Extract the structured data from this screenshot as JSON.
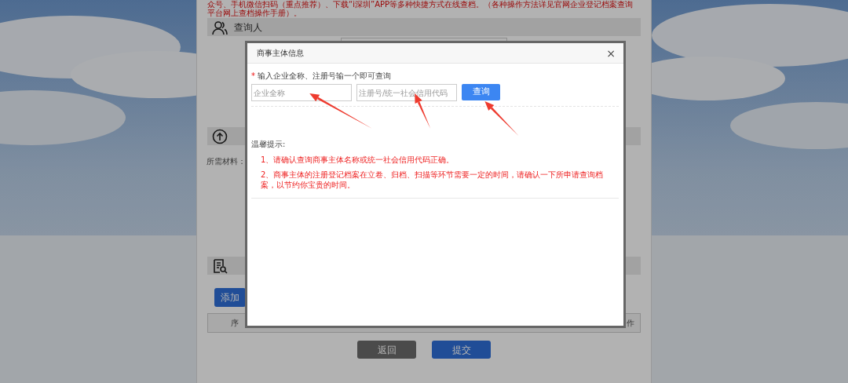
{
  "page": {
    "notice": "众号、手机微信扫码（重点推荐）、下载“i深圳”APP等多种快捷方式在线查档。（各种操作方法详见官网企业登记档案查询平台网上查档操作手册）。",
    "sections": [
      {
        "kind": "people",
        "title": "查询人"
      },
      {
        "kind": "upload",
        "materials_label": "所需材料："
      },
      {
        "kind": "document",
        "add_button": "添加",
        "table_columns": [
          "序",
          "作"
        ]
      }
    ],
    "footer_buttons": [
      {
        "label": "返回",
        "kind": "secondary"
      },
      {
        "label": "提交",
        "kind": "primary"
      }
    ]
  },
  "modal": {
    "title": "商事主体信息",
    "close": "×",
    "prompt_mark": "*",
    "prompt": "输入企业全称、注册号输一个即可查询",
    "fields": [
      {
        "placeholder": "企业全称",
        "arrow": true
      },
      {
        "placeholder": "注册号/统一社会信用代码",
        "arrow": true
      }
    ],
    "search_button": {
      "label": "查询",
      "arrow": true
    },
    "tips_title": "温馨提示:",
    "tips": [
      "1、请确认查询商事主体名称或统一社会信用代码正确。",
      "2、商事主体的注册登记档案在立卷、归档、扫描等环节需要一定的时间，请确认一下所申请查询档案，以节约你宝贵的时间。"
    ]
  }
}
